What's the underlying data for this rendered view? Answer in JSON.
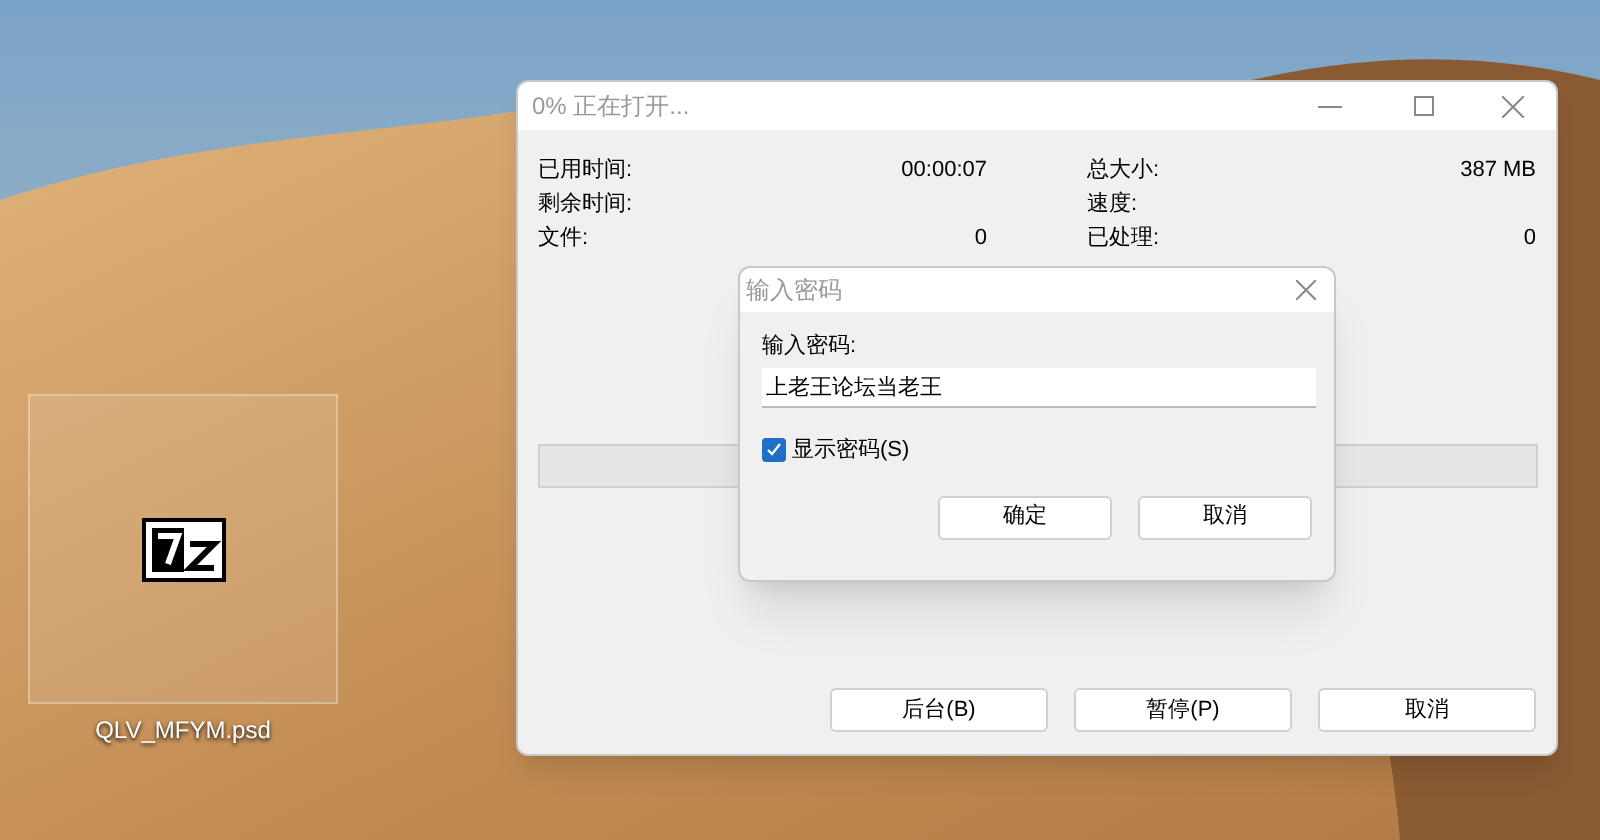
{
  "desktop_icon": {
    "label": "QLV_MFYM.psd",
    "selected": true
  },
  "progress_window": {
    "title": "0% 正在打开...",
    "stats_left": [
      {
        "label": "已用时间:",
        "value": "00:00:07"
      },
      {
        "label": "剩余时间:"
      },
      {
        "label": "文件:",
        "value": "0"
      }
    ],
    "stats_right": [
      {
        "label": "总大小:",
        "value": "387 MB"
      },
      {
        "label": "速度:"
      },
      {
        "label": "已处理:",
        "value": "0"
      }
    ],
    "progress": {
      "level": 0
    },
    "buttons": [
      "后台(B)",
      "暂停(P)",
      "取消"
    ]
  },
  "password_dialog": {
    "title": "输入密码",
    "field_label": "输入密码:",
    "value": "上老王论坛当老王",
    "show_password": {
      "label": "显示密码(S)",
      "checked": true
    },
    "buttons": [
      "确定",
      "取消"
    ]
  }
}
